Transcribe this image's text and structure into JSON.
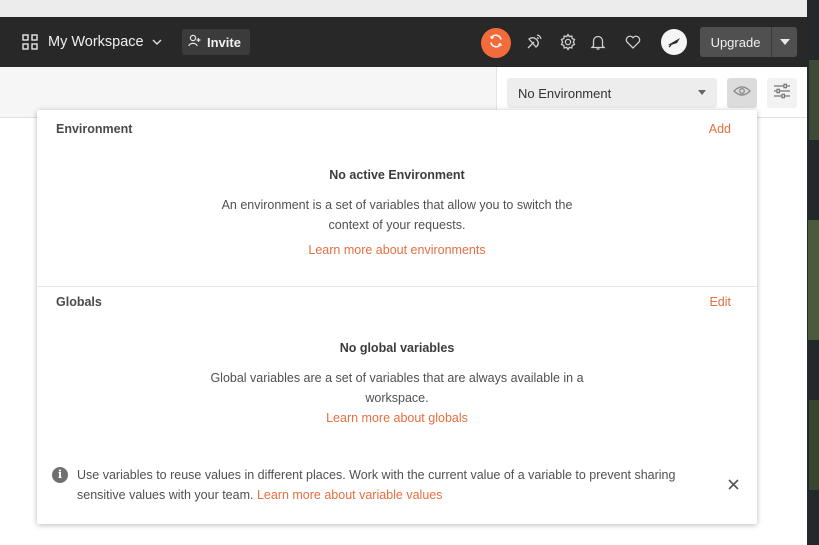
{
  "header": {
    "workspace_label": "My Workspace",
    "invite_label": "Invite",
    "upgrade_label": "Upgrade",
    "icons": [
      "apps-grid-icon",
      "chevron-down-icon",
      "add-user-icon",
      "sync-icon",
      "satellite-icon",
      "gear-icon",
      "bell-icon",
      "heart-icon",
      "avatar",
      "caret-down-icon"
    ],
    "accent_color": "#f26b3a"
  },
  "env_bar": {
    "selected_environment": "No Environment",
    "icons": [
      "eye-icon",
      "sliders-icon"
    ]
  },
  "panel": {
    "environment": {
      "title": "Environment",
      "action": "Add",
      "empty_title": "No active Environment",
      "description_line1": "An environment is a set of variables that allow you to switch the",
      "description_line2": "context of your requests.",
      "learn_more": "Learn more about environments"
    },
    "globals": {
      "title": "Globals",
      "action": "Edit",
      "empty_title": "No global variables",
      "description_line1": "Global variables are a set of variables that are always available in a",
      "description_line2": "workspace.",
      "learn_more": "Learn more about globals"
    },
    "info": {
      "icon_glyph": "i",
      "text": "Use variables to reuse values in different places. Work with the current value of a variable to prevent sharing sensitive values with your team. ",
      "link": "Learn more about variable values"
    },
    "link_color": "#e56f40"
  }
}
